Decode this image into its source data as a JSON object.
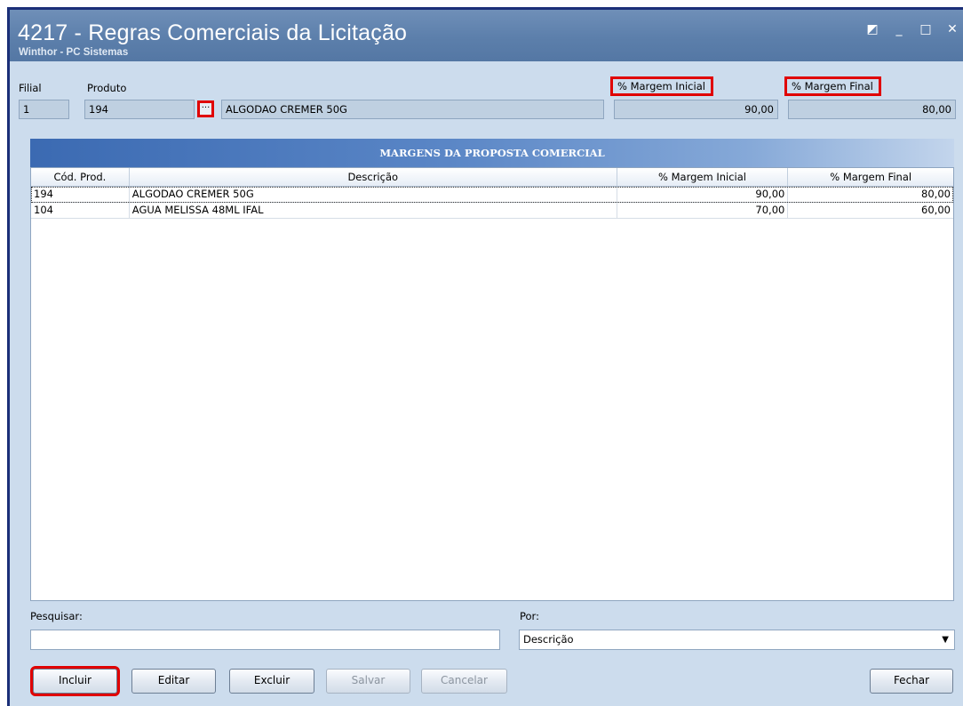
{
  "window": {
    "title": "4217 - Regras Comerciais da Licitação",
    "subtitle": "Winthor - PC Sistemas",
    "controls": {
      "restore": "◩",
      "minimize": "_",
      "maximize": "□",
      "close": "✕"
    }
  },
  "form": {
    "filial_label": "Filial",
    "filial_value": "1",
    "produto_label": "Produto",
    "produto_code": "194",
    "produto_lookup": "···",
    "produto_desc": "ALGODAO CREMER 50G",
    "margem_inicial_label": "% Margem Inicial",
    "margem_inicial_value": "90,00",
    "margem_final_label": "% Margem Final",
    "margem_final_value": "80,00"
  },
  "panel_title": "MARGENS DA PROPOSTA COMERCIAL",
  "grid": {
    "columns": [
      "Cód. Prod.",
      "Descrição",
      "% Margem Inicial",
      "% Margem Final"
    ],
    "rows": [
      {
        "cod": "194",
        "desc": "ALGODAO CREMER 50G",
        "inicial": "90,00",
        "final": "80,00"
      },
      {
        "cod": "104",
        "desc": "AGUA MELISSA 48ML IFAL",
        "inicial": "70,00",
        "final": "60,00"
      }
    ]
  },
  "search": {
    "label": "Pesquisar:",
    "value": "",
    "por_label": "Por:",
    "por_value": "Descrição"
  },
  "buttons": {
    "incluir": "Incluir",
    "editar": "Editar",
    "excluir": "Excluir",
    "salvar": "Salvar",
    "cancelar": "Cancelar",
    "fechar": "Fechar"
  },
  "colors": {
    "titlebar": "#5c7fab",
    "background": "#ccdced",
    "highlight": "#e00000",
    "panel_header": "#3b6ab2"
  }
}
